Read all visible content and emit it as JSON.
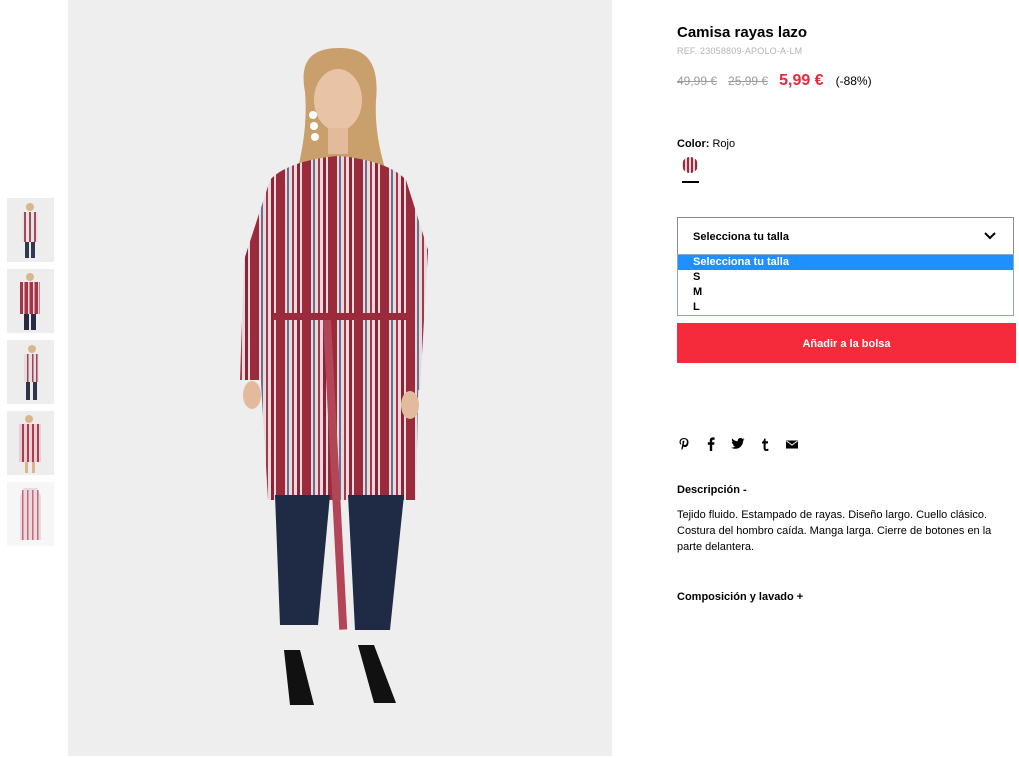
{
  "product": {
    "title": "Camisa rayas lazo",
    "ref": "REF. 23058809-APOLO-A-LM",
    "price_original": "49,99 €",
    "price_previous": "25,99 €",
    "price_current": "5,99 €",
    "discount": "(-88%)"
  },
  "color": {
    "label": "Color:",
    "value": "Rojo"
  },
  "size_select": {
    "selected": "Selecciona tu talla",
    "options": [
      "Selecciona tu talla",
      "S",
      "M",
      "L"
    ]
  },
  "add_to_bag_label": "Añadir a la bolsa",
  "share_icons": [
    "pinterest-icon",
    "facebook-icon",
    "twitter-icon",
    "tumblr-icon",
    "email-icon"
  ],
  "description": {
    "title": "Descripción -",
    "text": "Tejido fluido. Estampado de rayas. Diseño largo. Cuello clásico. Costura del hombro caída. Manga larga. Cierre de botones en la parte delantera."
  },
  "composition_title": "Composición y lavado +",
  "colors": {
    "accent": "#f52a3a",
    "price": "#e8283b",
    "select_highlight": "#1e90ff",
    "stripe": "#9e2a3e"
  }
}
